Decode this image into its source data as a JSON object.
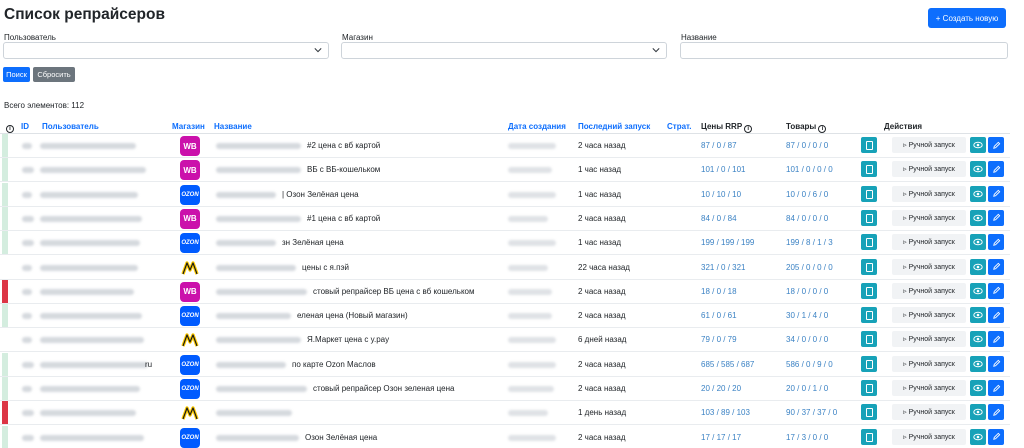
{
  "page": {
    "title": "Список репрайсеров",
    "create_label": "+ Создать новую"
  },
  "filters": {
    "user_label": "Пользователь",
    "shop_label": "Магазин",
    "name_label": "Название",
    "search_label": "Поиск",
    "reset_label": "Сбросить"
  },
  "total": "Всего элементов: 112",
  "columns": {
    "info": "i",
    "id": "ID",
    "user": "Пользователь",
    "shop": "Магазин",
    "name": "Название",
    "created": "Дата создания",
    "last_run": "Последний запуск",
    "strat": "Страт.",
    "rrp": "Цены RRP",
    "goods": "Товары",
    "actions": "Действия"
  },
  "run_label": "▹ Ручной запуск",
  "rows": [
    {
      "stripe": "#d4eddf",
      "shop": "wb",
      "shop_label": "WB",
      "name": "#2 цена с вб картой",
      "last": "2 часа назад",
      "rrp": "87 / 0 / 87",
      "goods": "87 / 0 / 0 / 0"
    },
    {
      "stripe": "#d4eddf",
      "shop": "wb",
      "shop_label": "WB",
      "name": "ВБ с ВБ-кошельком",
      "last": "1 час назад",
      "rrp": "101 / 0 / 101",
      "goods": "101 / 0 / 0 / 0"
    },
    {
      "stripe": "#d4eddf",
      "shop": "oz",
      "shop_label": "OZON",
      "name": "| Озон Зелёная цена",
      "last": "1 час назад",
      "rrp": "10 / 10 / 10",
      "goods": "10 / 0 / 6 / 0"
    },
    {
      "stripe": "#d4eddf",
      "shop": "wb",
      "shop_label": "WB",
      "name": "#1 цена с вб картой",
      "last": "2 часа назад",
      "rrp": "84 / 0 / 84",
      "goods": "84 / 0 / 0 / 0"
    },
    {
      "stripe": "#d4eddf",
      "shop": "oz",
      "shop_label": "OZON",
      "name": "зн Зелёная цена",
      "last": "1 час назад",
      "rrp": "199 / 199 / 199",
      "goods": "199 / 8 / 1 / 3"
    },
    {
      "stripe": "#ffffff",
      "shop": "ym",
      "shop_label": "M",
      "name": "цены с я.пэй",
      "last": "22 часа назад",
      "rrp": "321 / 0 / 321",
      "goods": "205 / 0 / 0 / 0"
    },
    {
      "stripe": "#dc3545",
      "shop": "wb",
      "shop_label": "WB",
      "name": "стовый репрайсер ВБ цена с вб кошельком",
      "last": "2 часа назад",
      "rrp": "18 / 0 / 18",
      "goods": "18 / 0 / 0 / 0"
    },
    {
      "stripe": "#d4eddf",
      "shop": "oz",
      "shop_label": "OZON",
      "name": "еленая цена (Новый магазин)",
      "last": "2 часа назад",
      "rrp": "61 / 0 / 61",
      "goods": "30 / 1 / 4 / 0"
    },
    {
      "stripe": "#ffffff",
      "shop": "ym",
      "shop_label": "M",
      "name": "Я.Маркет цена с y.pay",
      "last": "6 дней назад",
      "rrp": "79 / 0 / 79",
      "goods": "34 / 0 / 0 / 0"
    },
    {
      "stripe": "#d4eddf",
      "shop": "oz",
      "shop_label": "OZON",
      "name": "по карте Ozon Маслов",
      "last": "2 часа назад",
      "rrp": "685 / 585 / 687",
      "goods": "586 / 0 / 9 / 0"
    },
    {
      "stripe": "#d4eddf",
      "shop": "oz",
      "shop_label": "OZON",
      "name": "стовый репрайсер Озон зеленая цена",
      "last": "2 часа назад",
      "rrp": "20 / 20 / 20",
      "goods": "20 / 0 / 1 / 0"
    },
    {
      "stripe": "#dc3545",
      "shop": "ym",
      "shop_label": "M",
      "name": "",
      "last": "1 день назад",
      "rrp": "103 / 89 / 103",
      "goods": "90 / 37 / 37 / 0"
    },
    {
      "stripe": "#d4eddf",
      "shop": "oz",
      "shop_label": "OZON",
      "name": "Озон Зелёная цена",
      "last": "2 часа назад",
      "rrp": "17 / 17 / 17",
      "goods": "17 / 3 / 0 / 0"
    }
  ],
  "user_tail": "ru",
  "colors": {
    "primary": "#0d6efd",
    "info": "#17a2b8",
    "wb": "#cb11ab",
    "ozon": "#005bff",
    "ym_yellow": "#ffcc00"
  }
}
